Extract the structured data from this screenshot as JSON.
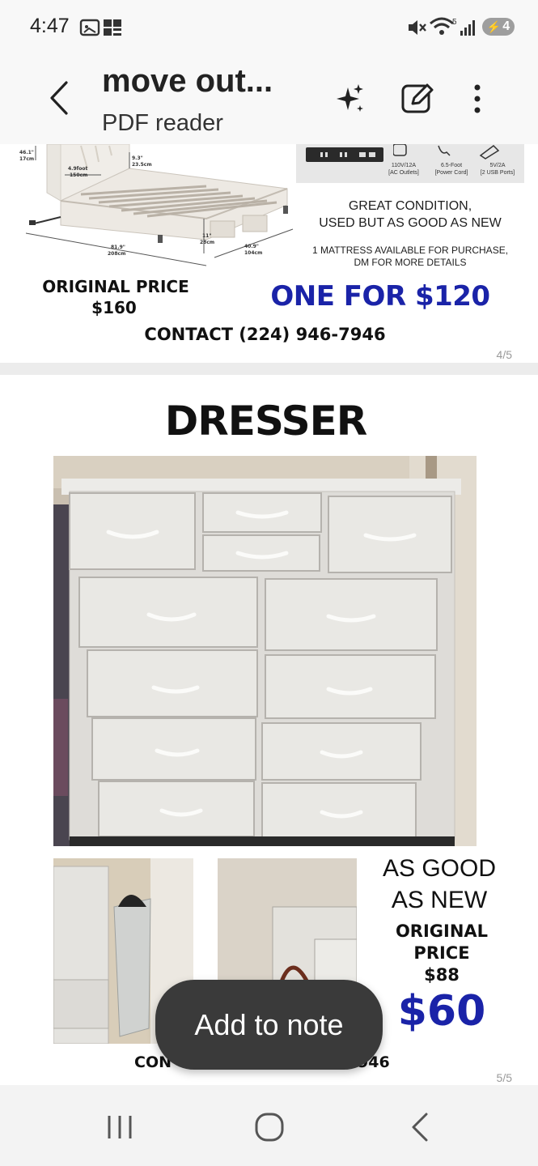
{
  "status": {
    "time": "4:47",
    "battery": "4",
    "wifi_label": "5"
  },
  "app_bar": {
    "title": "move out...",
    "subtitle": "PDF reader"
  },
  "page4": {
    "dims": {
      "height_in": "46.1\"",
      "height_cm": "17cm",
      "width_ft": "4.9foot",
      "width_cm": "150cm",
      "head_in": "9.3\"",
      "head_cm": "23.5cm",
      "side_in": "11\"",
      "side_cm": "28cm",
      "length_in": "81.9\"",
      "length_cm": "208cm",
      "depth_in": "40.9\"",
      "depth_cm": "104cm"
    },
    "features": [
      {
        "line1": "110V/12A",
        "line2": "[AC Outlets]"
      },
      {
        "line1": "6.5-Foot",
        "line2": "[Power Cord]"
      },
      {
        "line1": "5V/2A",
        "line2": "[2 USB Ports]"
      }
    ],
    "condition_line1": "GREAT CONDITION,",
    "condition_line2": "USED BUT AS GOOD AS NEW",
    "mattress_line1": "1 MATTRESS AVAILABLE FOR PURCHASE,",
    "mattress_line2": "DM FOR MORE DETAILS",
    "original_price_label": "ORIGINAL PRICE",
    "original_price": "$160",
    "offer": "ONE FOR $120",
    "contact": "CONTACT (224) 946-7946",
    "page_number": "4/5"
  },
  "page5": {
    "heading": "DRESSER",
    "condition_line1": "AS GOOD",
    "condition_line2": "AS NEW",
    "original_price_label1": "ORIGINAL",
    "original_price_label2": "PRICE",
    "original_price": "$88",
    "offer": "$60",
    "contact_prefix": "CON",
    "contact_suffix": "946",
    "page_number": "5/5"
  },
  "chip": {
    "label": "Add to note"
  },
  "colors": {
    "offer_blue": "#1a23a8",
    "chip_bg": "#3a3a3a"
  }
}
